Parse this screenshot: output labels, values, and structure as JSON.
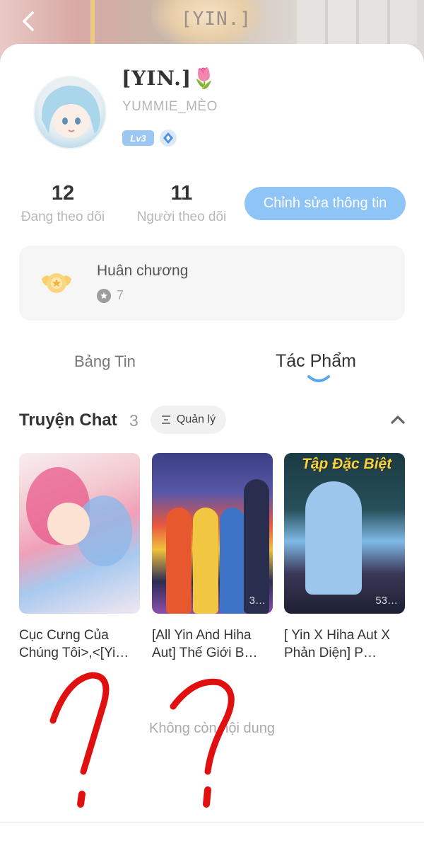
{
  "banner": {
    "title": "[YIN.]"
  },
  "profile": {
    "username": "[YIN.]🌷",
    "handle": "YUMMIE_MÈO",
    "level": "Lv3"
  },
  "stats": {
    "following_count": "12",
    "following_label": "Đang theo dõi",
    "followers_count": "11",
    "followers_label": "Người theo dõi",
    "edit_label": "Chỉnh sửa thông tin"
  },
  "medals": {
    "title": "Huân chương",
    "count": "7"
  },
  "tabs": [
    {
      "label": "Bảng Tin",
      "active": false
    },
    {
      "label": "Tác Phẩm",
      "active": true
    }
  ],
  "section": {
    "title": "Truyện Chat",
    "count": "3",
    "manage_label": "Quản lý"
  },
  "stories": [
    {
      "caption": "Cục Cưng Của Chúng Tôi>,<[Yi…",
      "views": ""
    },
    {
      "caption": "[All Yin And Hiha Aut] Thế Giới B…",
      "views": "3…"
    },
    {
      "caption": "[ Yin X Hiha Aut X Phản Diện] P…",
      "views": "53…",
      "banner_text": "Tập Đặc Biệt"
    }
  ],
  "empty_text": "Không còn nội dung",
  "colors": {
    "accent": "#8ec5f6",
    "scribble": "#e01010"
  }
}
